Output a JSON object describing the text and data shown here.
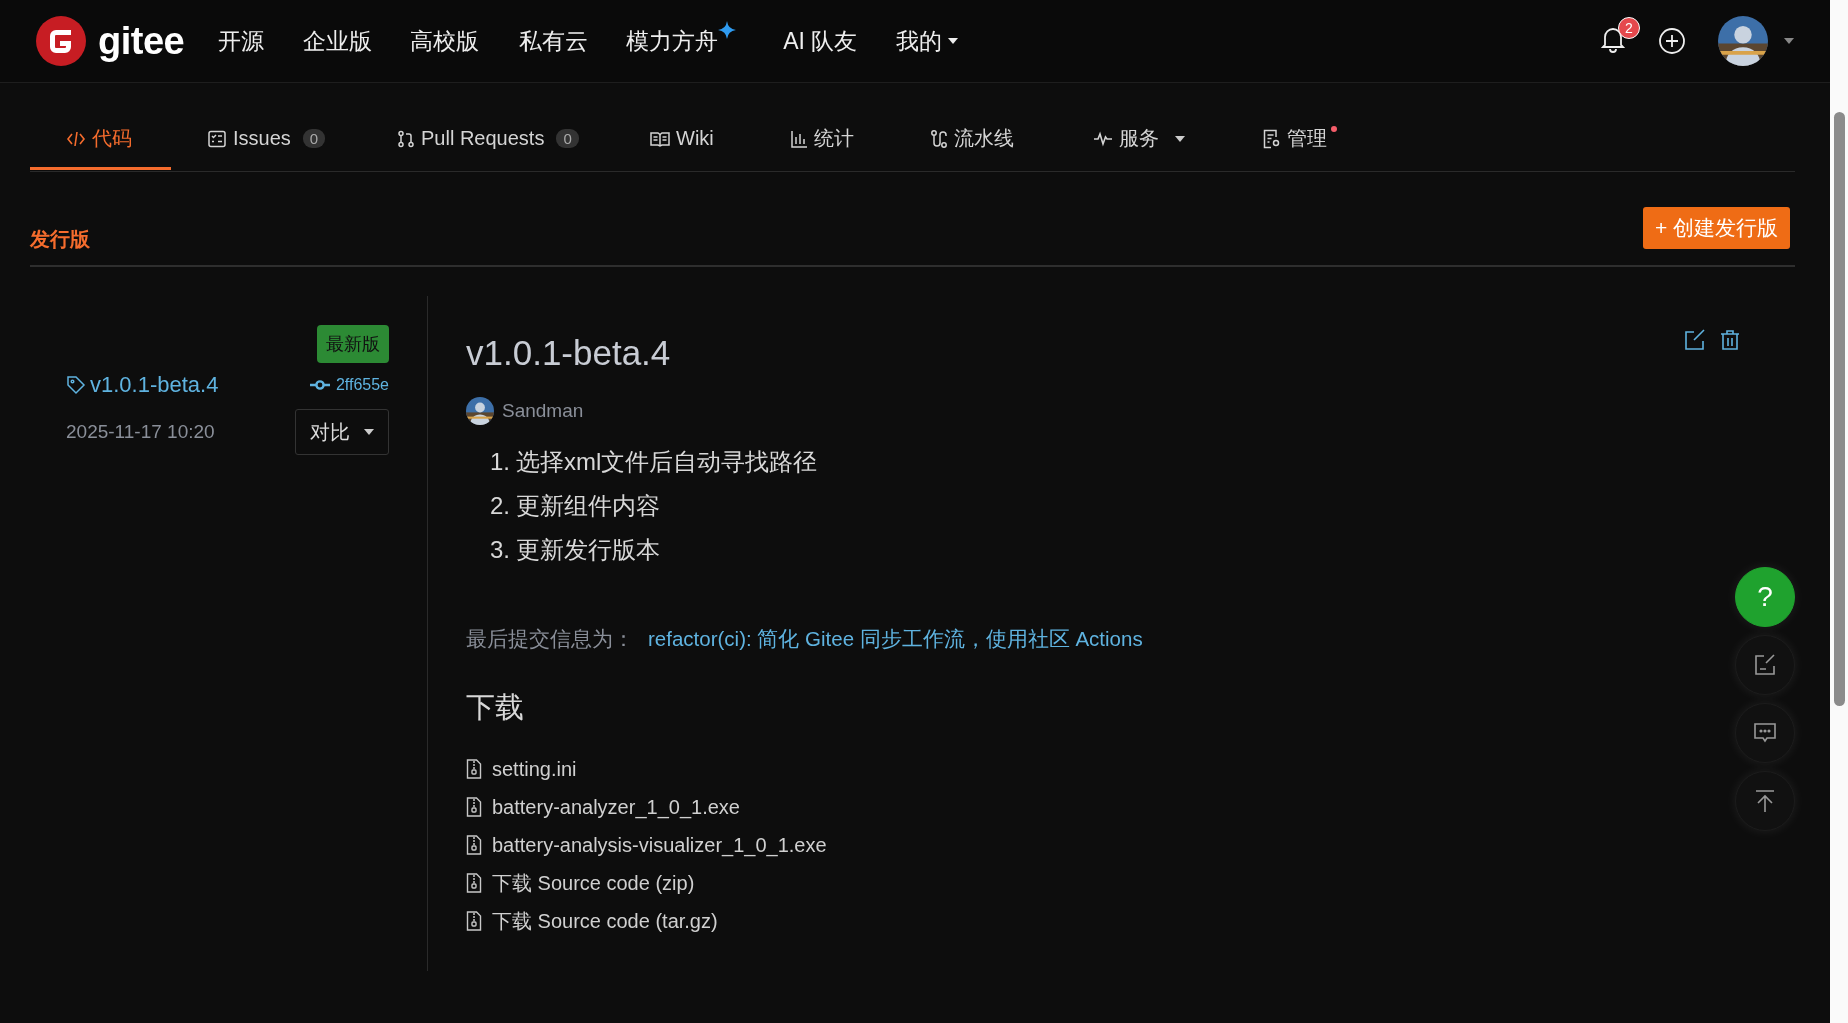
{
  "header": {
    "logo": "gitee",
    "nav": [
      {
        "label": "开源",
        "sparkle": false,
        "dropdown": false
      },
      {
        "label": "企业版",
        "sparkle": false,
        "dropdown": false
      },
      {
        "label": "高校版",
        "sparkle": false,
        "dropdown": false
      },
      {
        "label": "私有云",
        "sparkle": false,
        "dropdown": false
      },
      {
        "label": "模力方舟",
        "sparkle": true,
        "dropdown": false
      },
      {
        "label": "AI 队友",
        "sparkle": false,
        "dropdown": false
      },
      {
        "label": "我的",
        "sparkle": false,
        "dropdown": true
      }
    ],
    "notifications": "2"
  },
  "tabs": [
    {
      "kind": "code",
      "label": "代码",
      "selected": true,
      "dropdown": false,
      "dot": false
    },
    {
      "kind": "issues",
      "label": "Issues",
      "count": "0",
      "selected": false,
      "dropdown": false,
      "dot": false
    },
    {
      "kind": "pull",
      "label": "Pull Requests",
      "count": "0",
      "selected": false,
      "dropdown": false,
      "dot": false
    },
    {
      "kind": "wiki",
      "label": "Wiki",
      "selected": false,
      "dropdown": false,
      "dot": false
    },
    {
      "kind": "stats",
      "label": "统计",
      "selected": false,
      "dropdown": false,
      "dot": false
    },
    {
      "kind": "pipeline",
      "label": "流水线",
      "selected": false,
      "dropdown": false,
      "dot": false
    },
    {
      "kind": "service",
      "label": "服务",
      "selected": false,
      "dropdown": true,
      "dot": false
    },
    {
      "kind": "manage",
      "label": "管理",
      "selected": false,
      "dropdown": false,
      "dot": true
    }
  ],
  "releases": {
    "heading": "发行版",
    "create_button": "+ 创建发行版"
  },
  "release": {
    "latest_badge": "最新版",
    "tag": "v1.0.1-beta.4",
    "commit": "2ff655e",
    "date": "2025-11-17 10:20",
    "compare_button": "对比",
    "title": "v1.0.1-beta.4",
    "author": "Sandman",
    "notes": [
      {
        "number": "1.",
        "text": "选择xml文件后自动寻找路径"
      },
      {
        "number": "2.",
        "text": "更新组件内容"
      },
      {
        "number": "3.",
        "text": "更新发行版本"
      }
    ],
    "commit_info_label": "最后提交信息为：",
    "commit_message": "refactor(ci): 简化 Gitee 同步工作流，使用社区 Actions",
    "downloads_heading": "下载",
    "downloads": [
      "setting.ini",
      "battery-analyzer_1_0_1.exe",
      "battery-analysis-visualizer_1_0_1.exe",
      "下载 Source code (zip)",
      "下载 Source code (tar.gz)"
    ]
  },
  "float_buttons": [
    {
      "kind": "help",
      "label": "?"
    },
    {
      "kind": "feedback"
    },
    {
      "kind": "chat"
    },
    {
      "kind": "top"
    }
  ]
}
